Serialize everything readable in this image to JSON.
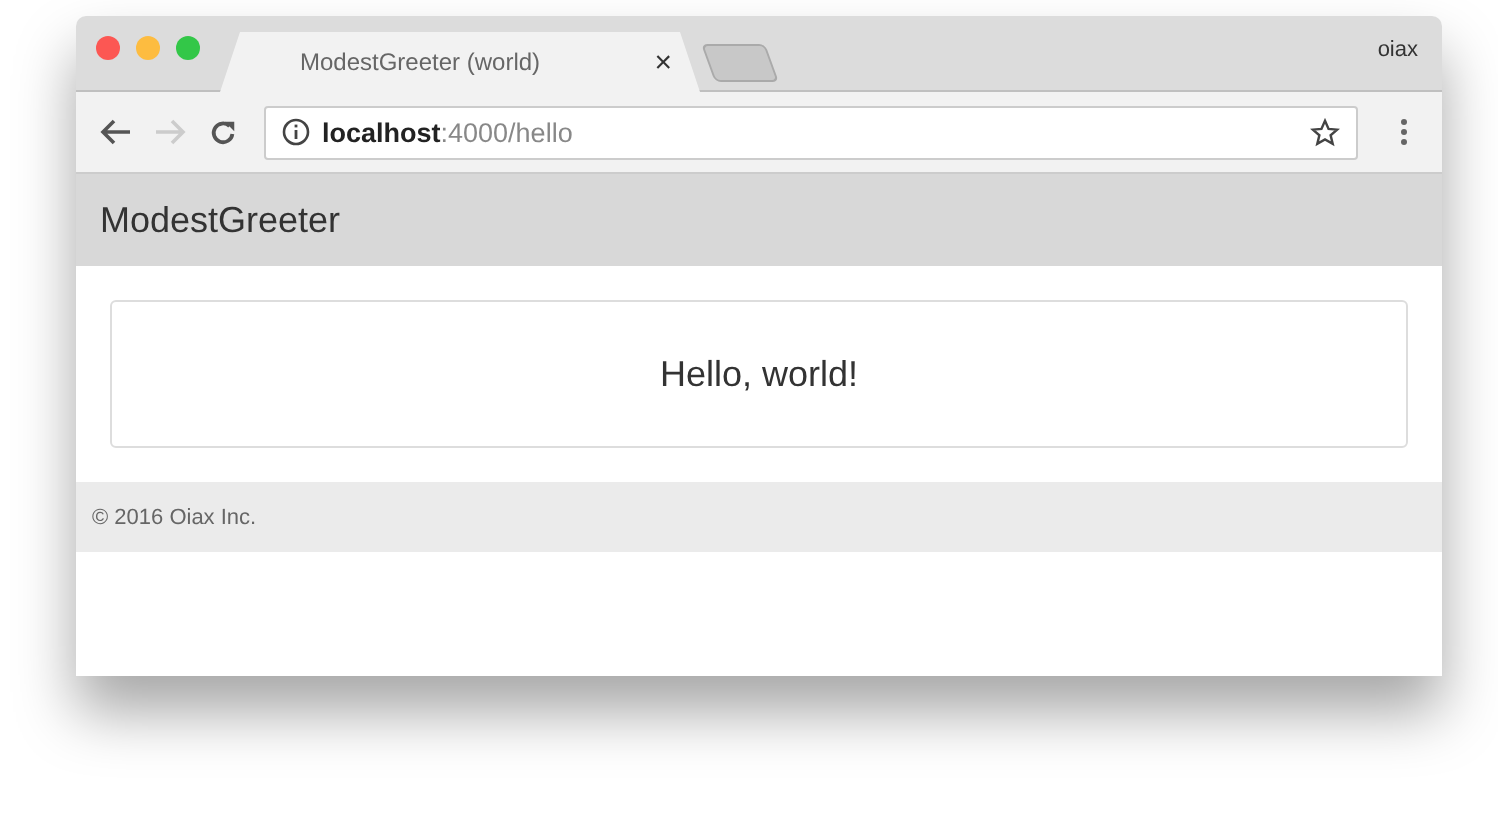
{
  "window": {
    "profile": "oiax"
  },
  "tabs": [
    {
      "title": "ModestGreeter (world)",
      "close": "×",
      "selected": true
    }
  ],
  "toolbar": {
    "back_disabled": false,
    "forward_disabled": true,
    "url": {
      "host": "localhost",
      "rest": ":4000/hello"
    }
  },
  "page": {
    "brand": "ModestGreeter",
    "message": "Hello, world!",
    "footer": "© 2016 Oiax Inc."
  }
}
